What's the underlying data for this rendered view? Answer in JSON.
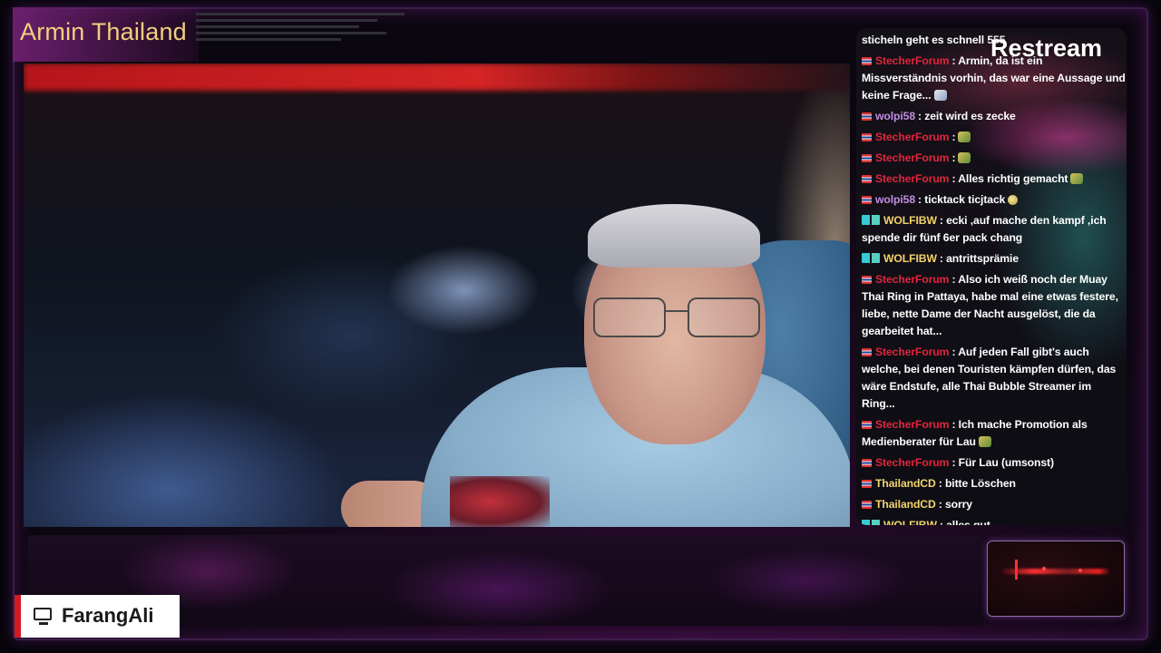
{
  "channel_title": "Armin Thailand",
  "watermark": "Restream",
  "credit": {
    "label": "FarangAli",
    "icon": "monitor-icon"
  },
  "colors": {
    "title": "#f3cf7e",
    "chat_user_stecher": "#e0253c",
    "chat_user_wolpi": "#c28ee0",
    "chat_user_yellow": "#f2d36a",
    "credit_accent": "#d41a22"
  },
  "chat": [
    {
      "user": "",
      "message": "sticheln geht es schnell 555",
      "badge": "none",
      "emoji": ""
    },
    {
      "user": "StecherForum",
      "message": ": Armin, da ist ein Missverständnis vorhin, das war eine Aussage und keine Frage...",
      "badge": "flag",
      "emoji": "emoji-ghost"
    },
    {
      "user": "wolpi58",
      "message": ": zeit wird es zecke",
      "badge": "flag",
      "emoji": ""
    },
    {
      "user": "StecherForum",
      "message": ":",
      "badge": "flag",
      "emoji": "emoji"
    },
    {
      "user": "StecherForum",
      "message": ":",
      "badge": "flag",
      "emoji": "emoji"
    },
    {
      "user": "StecherForum",
      "message": ": Alles richtig gemacht",
      "badge": "flag",
      "emoji": "emoji"
    },
    {
      "user": "wolpi58",
      "message": ": ticktack ticjtack",
      "badge": "flag",
      "emoji": "emoji-moon"
    },
    {
      "user": "WOLFIBW",
      "message": ": ecki ,auf mache den kampf ,ich spende dir fünf 6er pack chang",
      "badge": "yt",
      "emoji": ""
    },
    {
      "user": "WOLFIBW",
      "message": ": antrittsprämie",
      "badge": "yt",
      "emoji": ""
    },
    {
      "user": "StecherForum",
      "message": ": Also ich weiß noch der Muay Thai Ring in Pattaya, habe mal eine etwas festere, liebe, nette Dame der Nacht ausgelöst, die da gearbeitet hat...",
      "badge": "flag",
      "emoji": ""
    },
    {
      "user": "StecherForum",
      "message": ": Auf jeden Fall gibt's auch welche, bei denen Touristen kämpfen dürfen, das wäre Endstufe, alle Thai Bubble Streamer im Ring...",
      "badge": "flag",
      "emoji": ""
    },
    {
      "user": "StecherForum",
      "message": ": Ich mache Promotion als Medienberater für Lau",
      "badge": "flag",
      "emoji": "emoji"
    },
    {
      "user": "StecherForum",
      "message": ": Für Lau (umsonst)",
      "badge": "flag",
      "emoji": ""
    },
    {
      "user": "ThailandCD",
      "message": ": bitte Löschen",
      "badge": "flag",
      "emoji": ""
    },
    {
      "user": "ThailandCD",
      "message": ": sorry",
      "badge": "flag",
      "emoji": ""
    },
    {
      "user": "WOLFIBW",
      "message": ": alles gut",
      "badge": "yt",
      "emoji": ""
    }
  ]
}
